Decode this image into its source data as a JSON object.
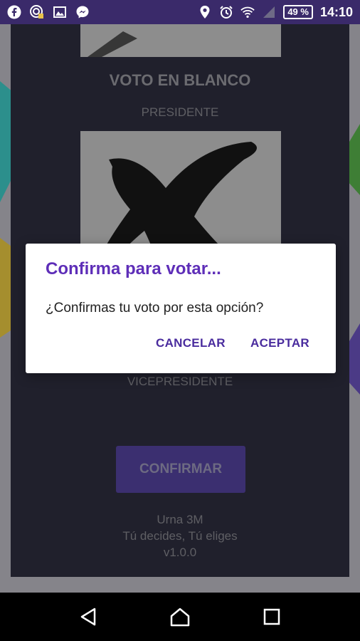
{
  "status_bar": {
    "battery": "49 %",
    "time": "14:10",
    "left_icons": [
      "facebook-icon",
      "target-icon",
      "gallery-icon",
      "messenger-icon"
    ],
    "right_icons": [
      "location-icon",
      "alarm-icon",
      "wifi-icon",
      "signal-icon"
    ]
  },
  "background": {
    "heading": "VOTO EN BLANCO",
    "role_president": "PRESIDENTE",
    "role_vice": "VICEPRESIDENTE",
    "confirm_button": "CONFIRMAR",
    "footer": {
      "line1": "Urna 3M",
      "line2": "Tú decides, Tú eliges",
      "line3": "v1.0.0"
    }
  },
  "dialog": {
    "title": "Confirma para votar...",
    "message": "¿Confirmas tu voto por esta opción?",
    "cancel": "CANCELAR",
    "accept": "ACEPTAR"
  },
  "colors": {
    "accent": "#5e2eb8",
    "button_text": "#4a2c9e",
    "status_bar": "#3a2a6a"
  }
}
